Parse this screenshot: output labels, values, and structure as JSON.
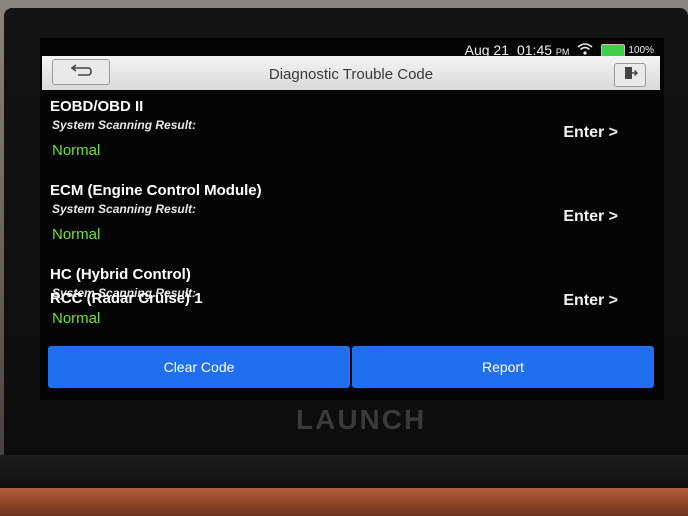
{
  "status_bar": {
    "date": "Aug 21",
    "time": "01:45",
    "ampm": "PM",
    "battery": "100%"
  },
  "header": {
    "title": "Diagnostic Trouble Code"
  },
  "systems": [
    {
      "name": "EOBD/OBD II",
      "subtitle": "System Scanning Result:",
      "status": "Normal",
      "action": "Enter >"
    },
    {
      "name": "ECM (Engine Control Module)",
      "subtitle": "System Scanning Result:",
      "status": "Normal",
      "action": "Enter >"
    },
    {
      "name": "HC (Hybrid Control)",
      "subtitle": "System Scanning Result:",
      "status": "Normal",
      "action": "Enter >"
    }
  ],
  "partial_item": "RCC (Radar Cruise) 1",
  "buttons": {
    "clear": "Clear Code",
    "report": "Report"
  },
  "brand": "LAUNCH",
  "colors": {
    "accent": "#1f6ff0",
    "normal": "#6fe03a"
  },
  "icons": {
    "back": "back-arrow-icon",
    "exit": "exit-icon",
    "wifi": "wifi-icon",
    "battery": "battery-icon"
  }
}
